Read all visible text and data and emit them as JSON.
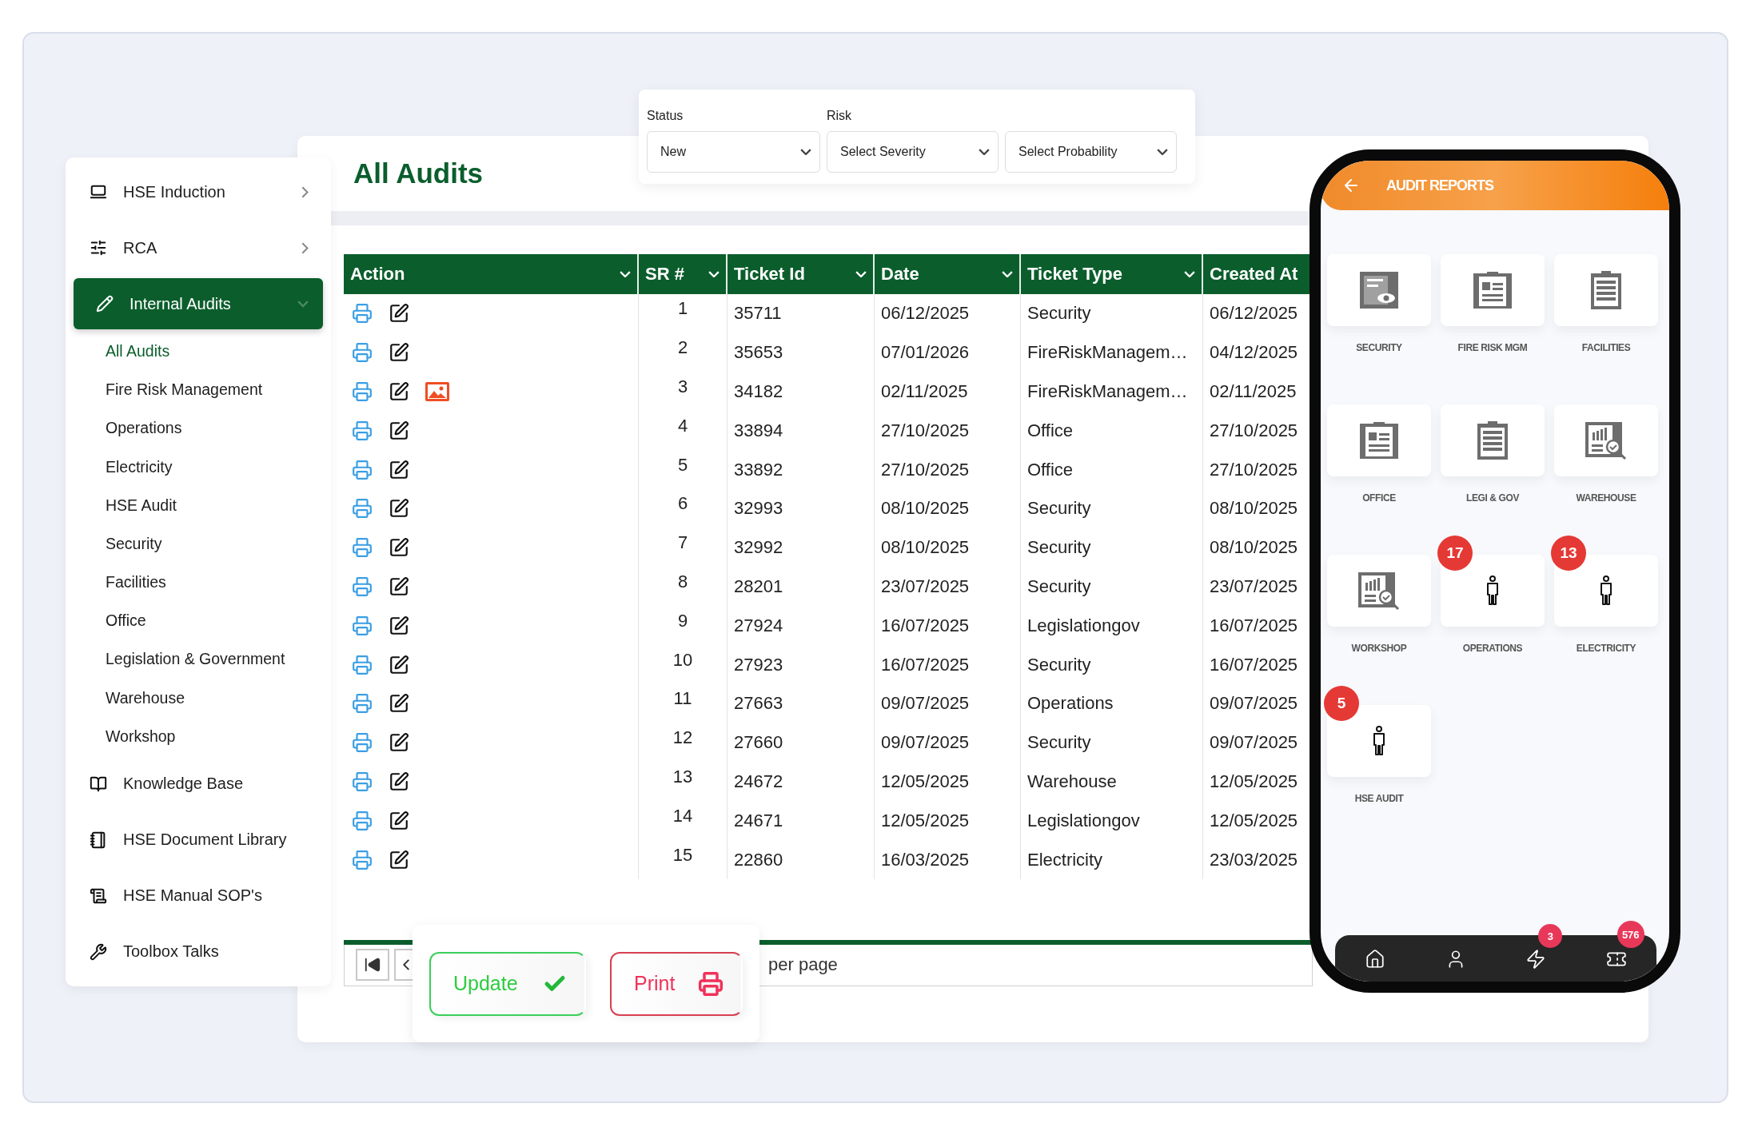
{
  "sidebar": {
    "items": [
      {
        "label": "HSE Induction",
        "selected": false,
        "expanded": false
      },
      {
        "label": "RCA",
        "selected": false,
        "expanded": false
      },
      {
        "label": "Internal Audits",
        "selected": true,
        "expanded": true,
        "children": [
          {
            "label": "All Audits",
            "selected": true
          },
          {
            "label": "Fire Risk Management",
            "selected": false
          },
          {
            "label": "Operations",
            "selected": false
          },
          {
            "label": "Electricity",
            "selected": false
          },
          {
            "label": "HSE Audit",
            "selected": false
          },
          {
            "label": "Security",
            "selected": false
          },
          {
            "label": "Facilities",
            "selected": false
          },
          {
            "label": "Office",
            "selected": false
          },
          {
            "label": "Legislation & Government",
            "selected": false
          },
          {
            "label": "Warehouse",
            "selected": false
          },
          {
            "label": "Workshop",
            "selected": false
          }
        ]
      },
      {
        "label": "Knowledge Base",
        "selected": false
      },
      {
        "label": "HSE Document Library",
        "selected": false
      },
      {
        "label": "HSE Manual SOP's",
        "selected": false
      },
      {
        "label": "Toolbox Talks",
        "selected": false
      }
    ]
  },
  "page_title": "All Audits",
  "filters": [
    {
      "label": "Status",
      "value": "New"
    },
    {
      "label": "Risk",
      "value": "Select Severity"
    },
    {
      "value": "Select Probability"
    }
  ],
  "table": {
    "columns": [
      "Action",
      "SR #",
      "Ticket Id",
      "Date",
      "Ticket Type",
      "Created At"
    ],
    "rows": [
      {
        "sr": "1",
        "ticket_id": "35711",
        "date": "06/12/2025",
        "ticket_type": "Security",
        "created_at": "06/12/2025",
        "image_attached": false
      },
      {
        "sr": "2",
        "ticket_id": "35653",
        "date": "07/01/2026",
        "ticket_type": "FireRiskManagem…",
        "created_at": "04/12/2025",
        "image_attached": false
      },
      {
        "sr": "3",
        "ticket_id": "34182",
        "date": "02/11/2025",
        "ticket_type": "FireRiskManagem…",
        "created_at": "02/11/2025",
        "image_attached": true
      },
      {
        "sr": "4",
        "ticket_id": "33894",
        "date": "27/10/2025",
        "ticket_type": "Office",
        "created_at": "27/10/2025",
        "image_attached": false
      },
      {
        "sr": "5",
        "ticket_id": "33892",
        "date": "27/10/2025",
        "ticket_type": "Office",
        "created_at": "27/10/2025",
        "image_attached": false
      },
      {
        "sr": "6",
        "ticket_id": "32993",
        "date": "08/10/2025",
        "ticket_type": "Security",
        "created_at": "08/10/2025",
        "image_attached": false
      },
      {
        "sr": "7",
        "ticket_id": "32992",
        "date": "08/10/2025",
        "ticket_type": "Security",
        "created_at": "08/10/2025",
        "image_attached": false
      },
      {
        "sr": "8",
        "ticket_id": "28201",
        "date": "23/07/2025",
        "ticket_type": "Security",
        "created_at": "23/07/2025",
        "image_attached": false
      },
      {
        "sr": "9",
        "ticket_id": "27924",
        "date": "16/07/2025",
        "ticket_type": "Legislationgov",
        "created_at": "16/07/2025",
        "image_attached": false
      },
      {
        "sr": "10",
        "ticket_id": "27923",
        "date": "16/07/2025",
        "ticket_type": "Security",
        "created_at": "16/07/2025",
        "image_attached": false
      },
      {
        "sr": "11",
        "ticket_id": "27663",
        "date": "09/07/2025",
        "ticket_type": "Operations",
        "created_at": "09/07/2025",
        "image_attached": false
      },
      {
        "sr": "12",
        "ticket_id": "27660",
        "date": "09/07/2025",
        "ticket_type": "Security",
        "created_at": "09/07/2025",
        "image_attached": false
      },
      {
        "sr": "13",
        "ticket_id": "24672",
        "date": "12/05/2025",
        "ticket_type": "Warehouse",
        "created_at": "12/05/2025",
        "image_attached": false
      },
      {
        "sr": "14",
        "ticket_id": "24671",
        "date": "12/05/2025",
        "ticket_type": "Legislationgov",
        "created_at": "12/05/2025",
        "image_attached": false
      },
      {
        "sr": "15",
        "ticket_id": "22860",
        "date": "16/03/2025",
        "ticket_type": "Electricity",
        "created_at": "23/03/2025",
        "image_attached": false
      }
    ]
  },
  "pagination": {
    "per_page": "per page"
  },
  "actions": [
    {
      "label": "Update",
      "kind": "update"
    },
    {
      "label": "Print",
      "kind": "print"
    }
  ],
  "phone": {
    "title": "AUDIT REPORTS",
    "tiles": [
      {
        "label": "SECURITY",
        "kind": "inspection"
      },
      {
        "label": "FIRE RISK MGM",
        "kind": "clipboard"
      },
      {
        "label": "FACILITIES",
        "kind": "checklist"
      },
      {
        "label": "OFFICE",
        "kind": "clipboard"
      },
      {
        "label": "LEGI & GOV",
        "kind": "checklist"
      },
      {
        "label": "WAREHOUSE",
        "kind": "report"
      },
      {
        "label": "WORKSHOP",
        "kind": "report"
      },
      {
        "label": "OPERATIONS",
        "kind": "person",
        "badge": "17"
      },
      {
        "label": "ELECTRICITY",
        "kind": "person",
        "badge": "13"
      },
      {
        "label": "HSE AUDIT",
        "kind": "person",
        "badge": "5"
      }
    ],
    "nav": [
      {
        "kind": "home"
      },
      {
        "kind": "user"
      },
      {
        "kind": "bolt",
        "badge": "3"
      },
      {
        "kind": "ticket",
        "badge": "576"
      }
    ]
  }
}
